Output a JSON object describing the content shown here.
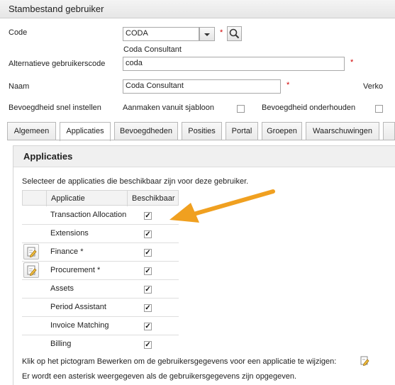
{
  "header": {
    "title": "Stambestand gebruiker"
  },
  "form": {
    "code_label": "Code",
    "code_value": "CODA",
    "code_required": "*",
    "code_description": "Coda Consultant",
    "alt_code_label": "Alternatieve gebruikerscode",
    "alt_code_value": "coda",
    "alt_code_required": "*",
    "name_label": "Naam",
    "name_value": "Coda Consultant",
    "name_required": "*",
    "truncated_label": "Verko",
    "quick_auth_label": "Bevoegdheid snel instellen",
    "create_from_template_label": "Aanmaken vanuit sjabloon",
    "maintain_auth_label": "Bevoegdheid onderhouden"
  },
  "tabs": [
    {
      "label": "Algemeen",
      "active": false
    },
    {
      "label": "Applicaties",
      "active": true
    },
    {
      "label": "Bevoegdheden",
      "active": false
    },
    {
      "label": "Posities",
      "active": false
    },
    {
      "label": "Portal",
      "active": false
    },
    {
      "label": "Groepen",
      "active": false
    },
    {
      "label": "Waarschuwingen",
      "active": false
    }
  ],
  "panel": {
    "title": "Applicaties",
    "instruction": "Selecteer de applicaties die beschikbaar zijn voor deze gebruiker.",
    "table": {
      "col_app": "Applicatie",
      "col_available": "Beschikbaar",
      "rows": [
        {
          "name": "Transaction Allocation",
          "available": true,
          "editable": false
        },
        {
          "name": "Extensions",
          "available": true,
          "editable": false
        },
        {
          "name": "Finance *",
          "available": true,
          "editable": true
        },
        {
          "name": "Procurement *",
          "available": true,
          "editable": true
        },
        {
          "name": "Assets",
          "available": true,
          "editable": false
        },
        {
          "name": "Period Assistant",
          "available": true,
          "editable": false
        },
        {
          "name": "Invoice Matching",
          "available": true,
          "editable": false
        },
        {
          "name": "Billing",
          "available": true,
          "editable": false
        }
      ]
    },
    "footnote_edit": "Klik op het pictogram Bewerken om de gebruikersgegevens voor een applicatie te wijzigen:",
    "footnote_asterisk": "Er wordt een asterisk weergegeven als de gebruikersgegevens zijn opgegeven."
  },
  "colors": {
    "arrow": "#f0a020",
    "required": "#d00000"
  }
}
